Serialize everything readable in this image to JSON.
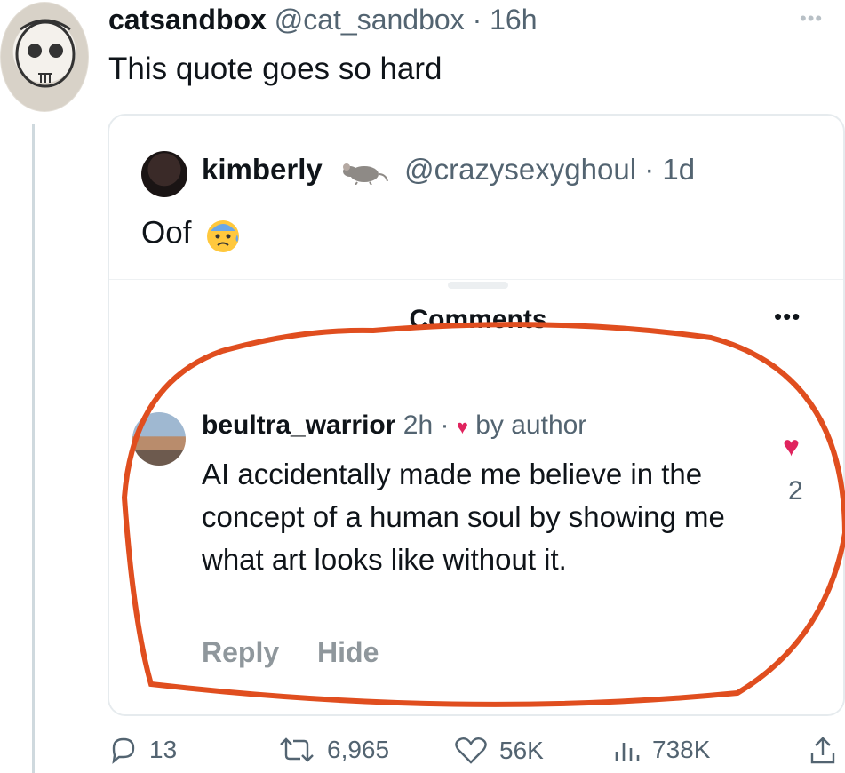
{
  "tweet": {
    "name": "catsandbox",
    "handle": "@cat_sandbox",
    "time": "· 16h",
    "text": "This quote goes so hard"
  },
  "quote": {
    "name": "kimberly",
    "handle": "@crazysexyghoul",
    "time": "· 1d",
    "text": "Oof"
  },
  "comments": {
    "title": "Comments",
    "item": {
      "name": "beultra_warrior",
      "time": "2h ·",
      "badge": "by author",
      "text": "AI accidentally made me believe in the concept of a human soul by showing me what art looks like without it.",
      "reply_label": "Reply",
      "hide_label": "Hide",
      "likes": "2"
    }
  },
  "actions": {
    "replies": "13",
    "retweets": "6,965",
    "likes": "56K",
    "views": "738K"
  },
  "colors": {
    "annotation": "#e04e1f",
    "like": "#e0245e",
    "secondary_text": "#536471"
  },
  "icons": [
    "skull-avatar",
    "rat-emoji",
    "anxious-face-emoji",
    "heart-icon",
    "reply-icon",
    "retweet-icon",
    "views-icon",
    "share-icon"
  ]
}
